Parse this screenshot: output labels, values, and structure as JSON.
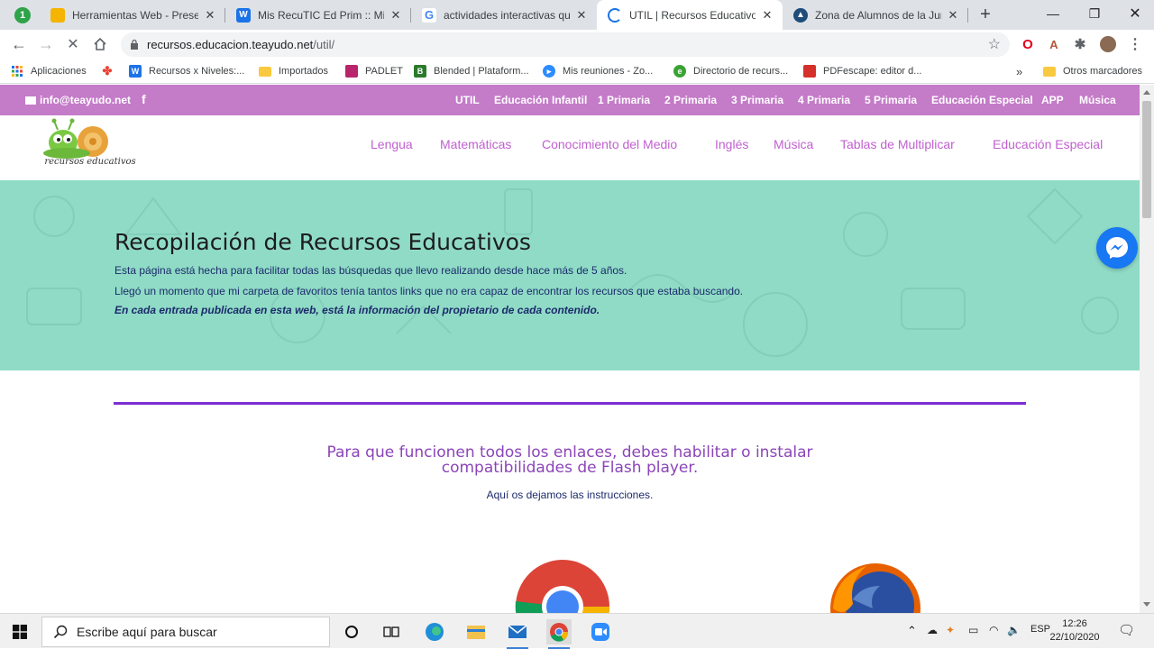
{
  "browser": {
    "tab_counter": "1",
    "tabs": [
      {
        "title": "Herramientas Web - Presenta",
        "favicon": "slides-icon",
        "color": "#f4b400"
      },
      {
        "title": "Mis RecuTIC Ed Prim :: Mis Re",
        "favicon": "w-icon",
        "color": "#1a73e8"
      },
      {
        "title": "actividades interactivas que i",
        "favicon": "google-icon",
        "color": "#4285f4"
      },
      {
        "title": "UTIL | Recursos Educativos In",
        "favicon": "loading-icon",
        "color": "#1a73e8",
        "active": true
      },
      {
        "title": "Zona de Alumnos de la Junta",
        "favicon": "junta-icon",
        "color": "#1e4d7a"
      }
    ],
    "new_tab": "+",
    "url_host": "recursos.educacion.teayudo.net",
    "url_path": "/util/",
    "bookmarks": [
      {
        "label": "Aplicaciones",
        "icon": "apps-grid-icon"
      },
      {
        "label": "",
        "icon": "pinwheel-icon"
      },
      {
        "label": "Recursos x Niveles:...",
        "icon": "w-icon"
      },
      {
        "label": "Importados",
        "icon": "folder-icon"
      },
      {
        "label": "PADLET",
        "icon": "padlet-icon"
      },
      {
        "label": "Blended | Plataform...",
        "icon": "blended-icon"
      },
      {
        "label": "Mis reuniones - Zo...",
        "icon": "zoom-icon"
      },
      {
        "label": "Directorio de recurs...",
        "icon": "edu-icon"
      },
      {
        "label": "PDFescape: editor d...",
        "icon": "pdf-icon"
      }
    ],
    "bookmarks_more": "»",
    "other_bookmarks": "Otros marcadores"
  },
  "site": {
    "email": "info@teayudo.net",
    "facebook": "f",
    "top_nav": [
      "UTIL",
      "Educación Infantil",
      "1 Primaria",
      "2 Primaria",
      "3 Primaria",
      "4 Primaria",
      "5 Primaria",
      "Educación Especial",
      "APP",
      "Música"
    ],
    "logo_text": "recursos educativos",
    "main_nav": [
      "Lengua",
      "Matemáticas",
      "Conocimiento del Medio",
      "Inglés",
      "Música",
      "Tablas de Multiplicar",
      "Educación Especial"
    ],
    "hero": {
      "title": "Recopilación de Recursos Educativos",
      "line1": "Esta página está hecha para facilitar todas las búsquedas que llevo realizando desde hace más de  5 años.",
      "line2": "Llegó un momento que mi carpeta de favoritos tenía tantos links que no era capaz de encontrar los recursos que estaba buscando.",
      "line3": "En cada entrada publicada en esta web, está la información del propietario de cada contenido."
    },
    "flash_message_line1": "Para que funcionen todos los enlaces, debes habilitar o instalar",
    "flash_message_line2": "compatibilidades de Flash player.",
    "instructions": "Aquí os dejamos las instrucciones."
  },
  "taskbar": {
    "search_placeholder": "Escribe aquí para buscar",
    "language": "ESP",
    "time": "12:26",
    "date": "22/10/2020"
  },
  "colors": {
    "topbar": "#c47bc8",
    "nav_text": "#c160d0",
    "hero_bg": "#8fdbc6",
    "divider": "#7d2fd0",
    "flash_text": "#8b45b8"
  }
}
